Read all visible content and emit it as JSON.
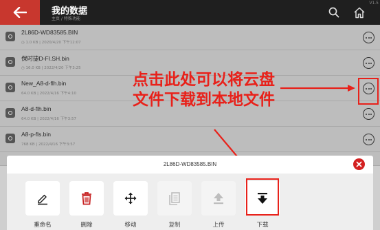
{
  "header": {
    "title": "我的数据",
    "breadcrumb": "主页 / 特殊功能",
    "version": "V1.5",
    "colors": {
      "bar": "#1f1f1f",
      "back": "#c8372e"
    }
  },
  "files": [
    {
      "name": "2L86D-WD83585.BIN",
      "meta": "◷ 1.0 KB | 2020/4/20 下午12:07"
    },
    {
      "name": "保时捷D-FI.SH.bin",
      "meta": "◷ 16.0 KB | 2022/4/20 下午3:25"
    },
    {
      "name": "New_A8-d-flh.bin",
      "meta": "64.0 KB | 2022/4/16 下午4:10"
    },
    {
      "name": "A8-d-flh.bin",
      "meta": "64.0 KB | 2022/4/16 下午3:57"
    },
    {
      "name": "A8-p-fls.bin",
      "meta": "768 KB | 2022/4/16 下午3:57"
    }
  ],
  "annotation": {
    "line1": "点击此处可以将云盘",
    "line2": "文件下载到本地文件",
    "color": "#e8211a"
  },
  "sheet": {
    "title": "2L86D-WD83585.BIN",
    "actions": [
      {
        "label": "重命名",
        "icon": "pencil-icon",
        "enabled": true
      },
      {
        "label": "删除",
        "icon": "trash-icon",
        "enabled": true
      },
      {
        "label": "移动",
        "icon": "move-arrows-icon",
        "enabled": true
      },
      {
        "label": "复制",
        "icon": "copy-icon",
        "enabled": false
      },
      {
        "label": "上传",
        "icon": "upload-icon",
        "enabled": false
      },
      {
        "label": "下载",
        "icon": "download-icon",
        "enabled": true
      }
    ]
  }
}
